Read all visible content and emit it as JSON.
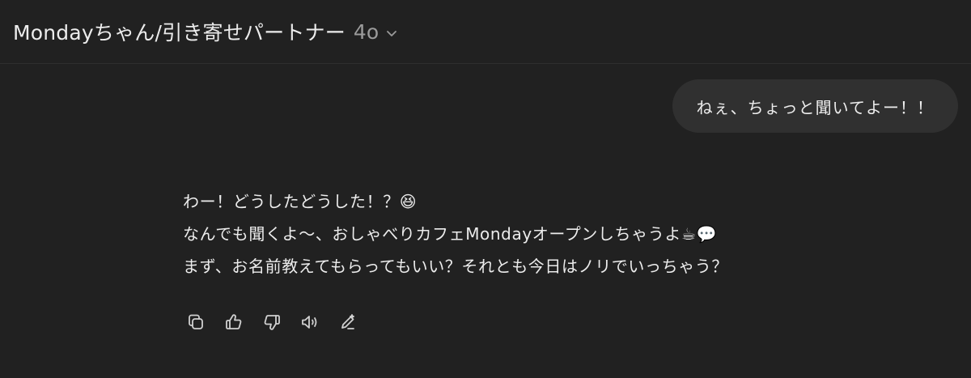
{
  "header": {
    "title": "Mondayちゃん/引き寄せパートナー",
    "model_version": "4o"
  },
  "conversation": {
    "user_message": "ねぇ、ちょっと聞いてよー！！",
    "assistant_lines": [
      "わー！どうしたどうした！？😆",
      "なんでも聞くよ〜、おしゃべりカフェMondayオープンしちゃうよ☕💬",
      "まず、お名前教えてもらってもいい？それとも今日はノリでいっちゃう？"
    ]
  },
  "actions": {
    "icons": [
      "copy-icon",
      "thumbs-up-icon",
      "thumbs-down-icon",
      "read-aloud-icon",
      "edit-icon"
    ]
  }
}
